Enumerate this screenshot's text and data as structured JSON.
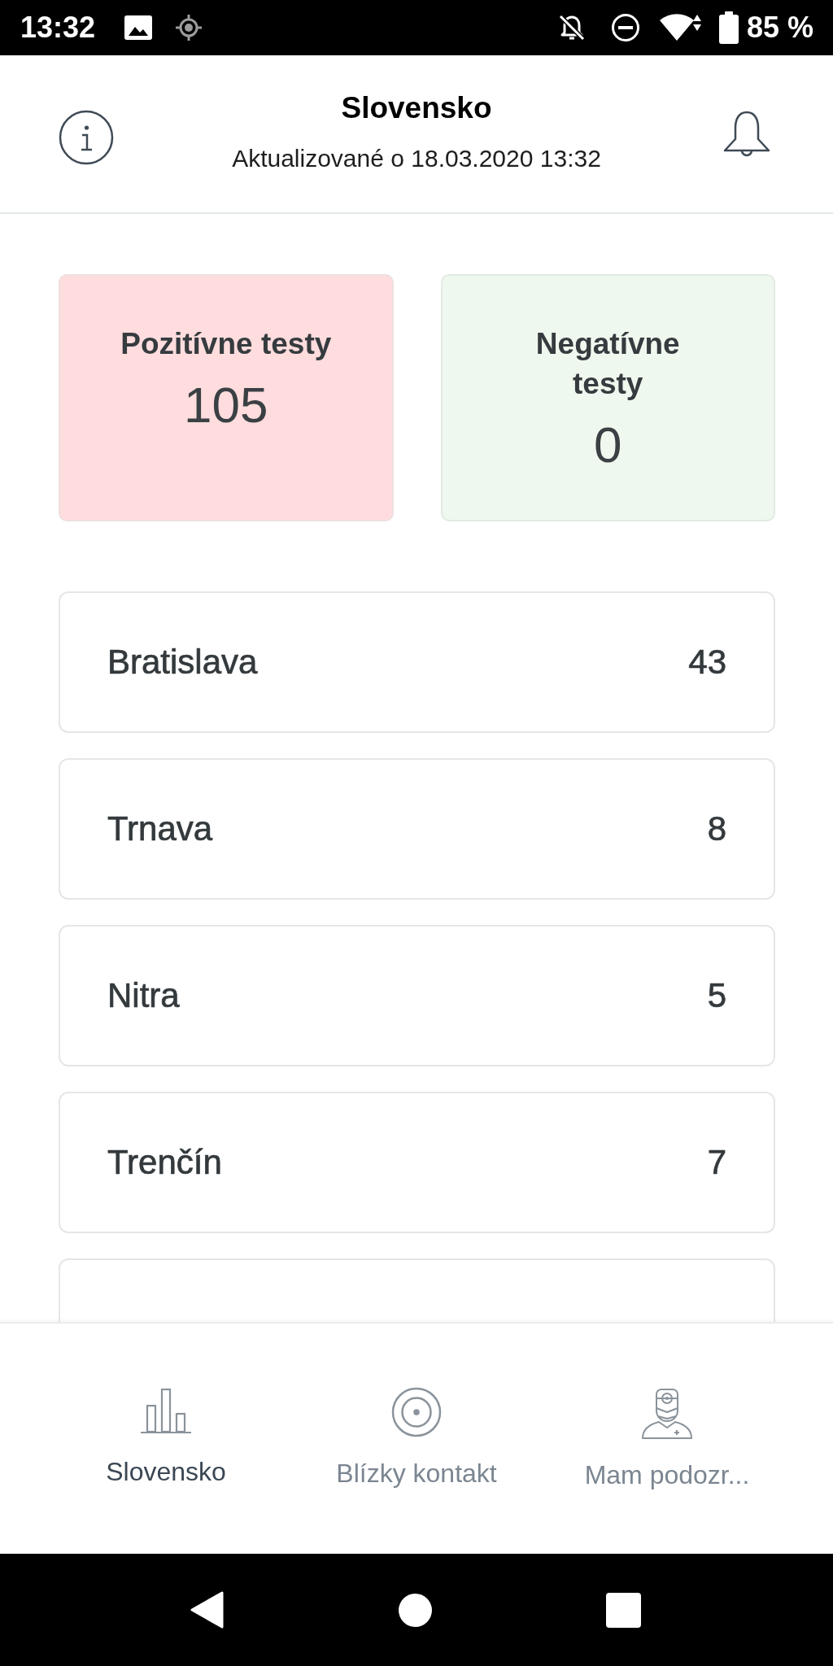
{
  "status_bar": {
    "time": "13:32",
    "battery": "85 %"
  },
  "header": {
    "title": "Slovensko",
    "subtitle": "Aktualizované o 18.03.2020 13:32"
  },
  "summary": [
    {
      "kind": "positive",
      "label": "Pozitívne testy",
      "value": "105"
    },
    {
      "kind": "negative",
      "label": "Negatívne testy",
      "value": "0"
    }
  ],
  "regions": {
    "rows": [
      {
        "name": "Bratislava",
        "count": "43"
      },
      {
        "name": "Trnava",
        "count": "8"
      },
      {
        "name": "Nitra",
        "count": "5"
      },
      {
        "name": "Trenčín",
        "count": "7"
      }
    ],
    "more_below": true
  },
  "tabs": [
    {
      "kind": "chart",
      "label": "Slovensko",
      "selected": true
    },
    {
      "kind": "target",
      "label": "Blízky kontakt",
      "selected": false
    },
    {
      "kind": "doctor",
      "label": "Mam podozr...",
      "selected": false
    }
  ]
}
